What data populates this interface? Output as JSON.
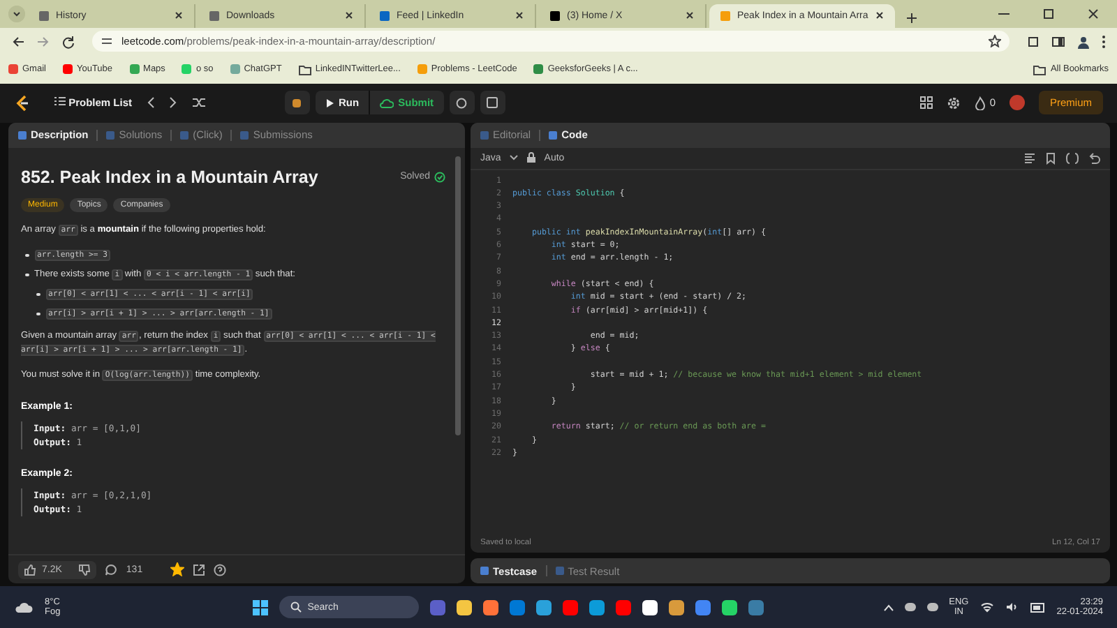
{
  "browser_tabs": [
    {
      "title": "History",
      "selected": false
    },
    {
      "title": "Downloads",
      "selected": false
    },
    {
      "title": "Feed | LinkedIn",
      "selected": false
    },
    {
      "title": "(3) Home / X",
      "selected": false
    },
    {
      "title": "Peak Index in a Mountain Arra",
      "selected": true
    }
  ],
  "address_bar": {
    "domain": "leetcode.com",
    "path": "/problems/peak-index-in-a-mountain-array/description/"
  },
  "bookmarks": [
    {
      "label": "Gmail"
    },
    {
      "label": "YouTube"
    },
    {
      "label": "Maps"
    },
    {
      "label": "o so"
    },
    {
      "label": "ChatGPT"
    },
    {
      "label": "LinkedINTwitterLee..."
    },
    {
      "label": "Problems - LeetCode"
    },
    {
      "label": "GeeksforGeeks | A c..."
    }
  ],
  "all_bookmarks": "All Bookmarks",
  "nav": {
    "problem_list": "Problem List",
    "run": "Run",
    "submit": "Submit",
    "streak": "0",
    "premium": "Premium"
  },
  "left_tabs": [
    {
      "label": "Description",
      "selected": true
    },
    {
      "label": "Solutions",
      "selected": false
    },
    {
      "label": "(Click)",
      "selected": false
    },
    {
      "label": "Submissions",
      "selected": false
    }
  ],
  "problem": {
    "title": "852. Peak Index in a Mountain Array",
    "status": "Solved",
    "difficulty": "Medium",
    "tags": [
      "Topics",
      "Companies"
    ]
  },
  "description": [
    {
      "kind": "paragraph",
      "segments": [
        {
          "kind": "text",
          "text": "An array "
        },
        {
          "kind": "code",
          "text": "arr"
        },
        {
          "kind": "text",
          "text": " is a "
        },
        {
          "kind": "bold",
          "text": "mountain"
        },
        {
          "kind": "text",
          "text": " if the following properties hold:"
        }
      ]
    },
    {
      "kind": "bullets",
      "items": [
        {
          "segments": [
            {
              "kind": "code",
              "text": "arr.length >= 3"
            }
          ]
        },
        {
          "segments": [
            {
              "kind": "text",
              "text": "There exists some "
            },
            {
              "kind": "code",
              "text": "i"
            },
            {
              "kind": "text",
              "text": " with "
            },
            {
              "kind": "code",
              "text": "0 < i < arr.length - 1"
            },
            {
              "kind": "text",
              "text": " such that:"
            }
          ],
          "children": [
            {
              "segments": [
                {
                  "kind": "code",
                  "text": "arr[0] < arr[1] < ... < arr[i - 1] < arr[i]"
                }
              ]
            },
            {
              "segments": [
                {
                  "kind": "code",
                  "text": "arr[i] > arr[i + 1] > ... > arr[arr.length - 1]"
                }
              ]
            }
          ]
        }
      ]
    },
    {
      "kind": "paragraph",
      "segments": [
        {
          "kind": "text",
          "text": "Given a mountain array "
        },
        {
          "kind": "code",
          "text": "arr"
        },
        {
          "kind": "text",
          "text": ", return the index "
        },
        {
          "kind": "code",
          "text": "i"
        },
        {
          "kind": "text",
          "text": " such that "
        },
        {
          "kind": "code",
          "text": "arr[0] < arr[1] < ... < arr[i - 1] < arr[i] > arr[i + 1] > ... > arr[arr.length - 1]"
        },
        {
          "kind": "text",
          "text": "."
        }
      ]
    },
    {
      "kind": "paragraph",
      "segments": [
        {
          "kind": "text",
          "text": "You must solve it in "
        },
        {
          "kind": "code",
          "text": "O(log(arr.length))"
        },
        {
          "kind": "text",
          "text": " time complexity."
        }
      ]
    },
    {
      "kind": "example",
      "title": "Example 1:",
      "lines": [
        {
          "label": "Input:",
          "value": "arr = [0,1,0]"
        },
        {
          "label": "Output:",
          "value": "1"
        }
      ]
    },
    {
      "kind": "example",
      "title": "Example 2:",
      "lines": [
        {
          "label": "Input:",
          "value": "arr = [0,2,1,0]"
        },
        {
          "label": "Output:",
          "value": "1"
        }
      ]
    }
  ],
  "left_footer": {
    "likes": "7.2K",
    "comments": "131",
    "favorite": true
  },
  "right_tabs": [
    {
      "label": "Editorial",
      "selected": false
    },
    {
      "label": "Code",
      "selected": true
    }
  ],
  "editor": {
    "language": "Java",
    "mode": "Auto",
    "status": "Saved to local",
    "cursor": "Ln 12, Col 17",
    "lines": [
      {
        "num": "1",
        "current": false
      },
      {
        "num": "2",
        "current": false,
        "tokens": [
          {
            "kind": "keyword",
            "text": "public class "
          },
          {
            "kind": "class",
            "text": "Solution"
          },
          {
            "kind": "plain",
            "text": " {"
          }
        ]
      },
      {
        "num": "3",
        "current": false
      },
      {
        "num": "4",
        "current": false
      },
      {
        "num": "5",
        "current": false,
        "tokens": [
          {
            "kind": "keyword",
            "text": "    public int "
          },
          {
            "kind": "function",
            "text": "peakIndexInMountainArray"
          },
          {
            "kind": "plain",
            "text": "("
          },
          {
            "kind": "keyword",
            "text": "int"
          },
          {
            "kind": "plain",
            "text": "[] arr) {"
          }
        ]
      },
      {
        "num": "6",
        "current": false,
        "tokens": [
          {
            "kind": "keyword",
            "text": "        int"
          },
          {
            "kind": "plain",
            "text": " start = 0;"
          }
        ]
      },
      {
        "num": "7",
        "current": false,
        "tokens": [
          {
            "kind": "keyword",
            "text": "        int"
          },
          {
            "kind": "plain",
            "text": " end = arr.length - 1;"
          }
        ]
      },
      {
        "num": "8",
        "current": false
      },
      {
        "num": "9",
        "current": false,
        "tokens": [
          {
            "kind": "control",
            "text": "        while"
          },
          {
            "kind": "plain",
            "text": " (start < end) {"
          }
        ]
      },
      {
        "num": "10",
        "current": false,
        "tokens": [
          {
            "kind": "keyword",
            "text": "            int"
          },
          {
            "kind": "plain",
            "text": " mid = start + (end - start) / 2;"
          }
        ]
      },
      {
        "num": "11",
        "current": false,
        "tokens": [
          {
            "kind": "control",
            "text": "            if"
          },
          {
            "kind": "plain",
            "text": " (arr[mid] > arr[mid+1]) {"
          }
        ]
      },
      {
        "num": "12",
        "current": true
      },
      {
        "num": "13",
        "current": false,
        "tokens": [
          {
            "kind": "plain",
            "text": "                end = mid;"
          }
        ]
      },
      {
        "num": "14",
        "current": false,
        "tokens": [
          {
            "kind": "plain",
            "text": "            } "
          },
          {
            "kind": "control",
            "text": "else"
          },
          {
            "kind": "plain",
            "text": " {"
          }
        ]
      },
      {
        "num": "15",
        "current": false
      },
      {
        "num": "16",
        "current": false,
        "tokens": [
          {
            "kind": "plain",
            "text": "                start = mid + 1; "
          },
          {
            "kind": "comment",
            "text": "// because we know that mid+1 element > mid element"
          }
        ]
      },
      {
        "num": "17",
        "current": false,
        "tokens": [
          {
            "kind": "plain",
            "text": "            }"
          }
        ]
      },
      {
        "num": "18",
        "current": false,
        "tokens": [
          {
            "kind": "plain",
            "text": "        }"
          }
        ]
      },
      {
        "num": "19",
        "current": false
      },
      {
        "num": "20",
        "current": false,
        "tokens": [
          {
            "kind": "control",
            "text": "        return"
          },
          {
            "kind": "plain",
            "text": " start; "
          },
          {
            "kind": "comment",
            "text": "// or return end as both are ="
          }
        ]
      },
      {
        "num": "21",
        "current": false,
        "tokens": [
          {
            "kind": "plain",
            "text": "    }"
          }
        ]
      },
      {
        "num": "22",
        "current": false,
        "tokens": [
          {
            "kind": "plain",
            "text": "}"
          }
        ]
      }
    ]
  },
  "bottom_tabs": [
    {
      "label": "Testcase",
      "selected": true
    },
    {
      "label": "Test Result",
      "selected": false
    }
  ],
  "taskbar": {
    "temperature": "8°C",
    "weather": "Fog",
    "search_placeholder": "Search",
    "language": "ENG",
    "region": "IN",
    "time": "23:29",
    "date": "22-01-2024"
  }
}
